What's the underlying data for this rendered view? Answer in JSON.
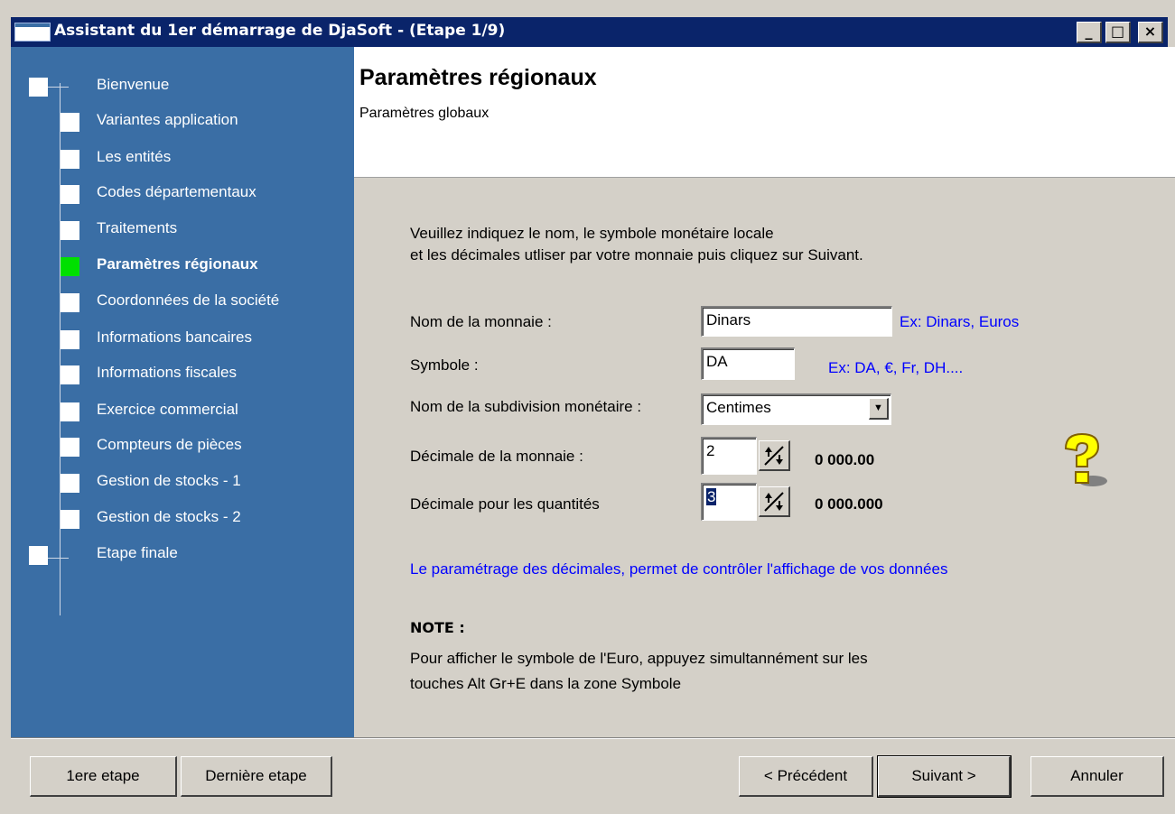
{
  "window": {
    "title": "Assistant du 1er démarrage de DjaSoft -   (Etape 1/9)",
    "minimize": "_",
    "maximize": "□",
    "close": "×"
  },
  "sidebar": {
    "steps": [
      {
        "label": "Bienvenue",
        "active": false
      },
      {
        "label": "Variantes application",
        "active": false
      },
      {
        "label": "Les entités",
        "active": false
      },
      {
        "label": "Codes départementaux",
        "active": false
      },
      {
        "label": "Traitements",
        "active": false
      },
      {
        "label": "Paramètres régionaux",
        "active": true
      },
      {
        "label": "Coordonnées de la société",
        "active": false
      },
      {
        "label": "Informations bancaires",
        "active": false
      },
      {
        "label": "Informations fiscales",
        "active": false
      },
      {
        "label": "Exercice commercial",
        "active": false
      },
      {
        "label": "Compteurs de pièces",
        "active": false
      },
      {
        "label": "Gestion de stocks - 1",
        "active": false
      },
      {
        "label": "Gestion de stocks - 2",
        "active": false
      },
      {
        "label": "Etape finale",
        "active": false
      }
    ]
  },
  "header": {
    "title": "Paramètres régionaux",
    "subtitle": "Paramètres globaux"
  },
  "form": {
    "intro_line1": "Veuillez indiquez le nom, le symbole monétaire locale",
    "intro_line2": "et les décimales utliser par votre monnaie puis cliquez sur Suivant.",
    "currency_name_label": "Nom de la monnaie :",
    "currency_name_value": "Dinars",
    "currency_name_example": "Ex: Dinars, Euros",
    "symbol_label": "Symbole :",
    "symbol_value": "DA",
    "symbol_example": "Ex: DA, €, Fr,  DH....",
    "subdivision_label": "Nom de la subdivision monétaire :",
    "subdivision_value": "Centimes",
    "currency_decimals_label": "Décimale de la monnaie :",
    "currency_decimals_value": "2",
    "currency_decimals_preview": "0 000.00",
    "qty_decimals_label": "Décimale pour les quantités",
    "qty_decimals_value": "3",
    "qty_decimals_preview": "0 000.000",
    "info_text": "Le paramétrage des décimales,  permet de contrôler l'affichage de vos données",
    "note_title": "NOTE :",
    "note_line1": "Pour afficher le symbole de l'Euro, appuyez simultannément sur les",
    "note_line2": "touches Alt Gr+E dans la zone Symbole"
  },
  "buttons": {
    "first_step": "1ere etape",
    "last_step": "Dernière etape",
    "previous": "< Précédent",
    "next": "Suivant >",
    "cancel": "Annuler"
  },
  "colors": {
    "sidebar_bg": "#3a6ea5",
    "active_step": "#00e000",
    "title_bar": "#0a246a",
    "link_blue": "#0000ff"
  }
}
